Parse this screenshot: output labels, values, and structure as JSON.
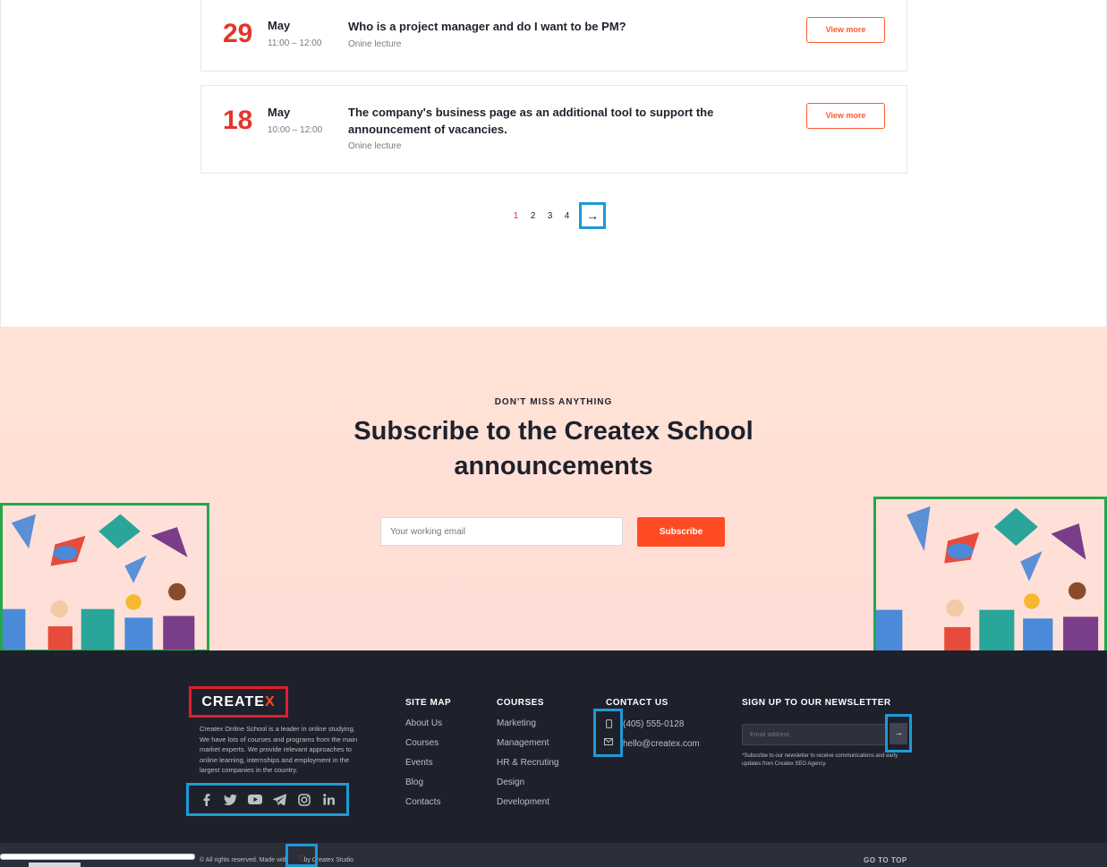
{
  "events": [
    {
      "day": "29",
      "month": "May",
      "time": "11:00 – 12:00",
      "title": "Who is a project manager and do I want to be PM?",
      "type": "Onine lecture",
      "button": "View more"
    },
    {
      "day": "18",
      "month": "May",
      "time": "10:00 – 12:00",
      "title": "The company's business page as an additional tool to support the announcement of vacancies.",
      "type": "Onine lecture",
      "button": "View more"
    }
  ],
  "pagination": {
    "pages": [
      "1",
      "2",
      "3",
      "4"
    ],
    "active": "1",
    "next": "→"
  },
  "subscribe": {
    "eyebrow": "DON'T MISS ANYTHING",
    "title": "Subscribe to the Createx School announcements",
    "placeholder": "Your working email",
    "button": "Subscribe"
  },
  "footer": {
    "logo_main": "CREATE",
    "logo_x": "X",
    "about": "Createx Online School is a leader in online studying. We have lots of courses and programs from the main market experts. We provide relevant approaches to online learning, internships and employment in the largest companies in the country.",
    "social": [
      "facebook-icon",
      "twitter-icon",
      "youtube-icon",
      "telegram-icon",
      "instagram-icon",
      "linkedin-icon"
    ],
    "sitemap": {
      "title": "SITE MAP",
      "items": [
        "About Us",
        "Courses",
        "Events",
        "Blog",
        "Contacts"
      ]
    },
    "courses": {
      "title": "COURSES",
      "items": [
        "Marketing",
        "Management",
        "HR & Recruting",
        "Design",
        "Development"
      ]
    },
    "contact": {
      "title": "CONTACT US",
      "phone": "(405) 555-0128",
      "email": "hello@createx.com"
    },
    "newsletter": {
      "title": "SIGN UP TO OUR NEWSLETTER",
      "placeholder": "Email address",
      "button": "→",
      "note": "*Subscribe to our newsletter to receive communications and early updates from Createx SEO Agency."
    },
    "copyright_left": "© All rights reserved. Made with",
    "copyright_right": "by Createx Studio",
    "go_top": "GO TO TOP"
  },
  "colors": {
    "accent": "#ff4b24",
    "date": "#e5352a",
    "footer_bg": "#1e212c",
    "highlight_blue": "#1e9ad6",
    "highlight_green": "#26a64b",
    "highlight_red": "#e01e2d"
  }
}
